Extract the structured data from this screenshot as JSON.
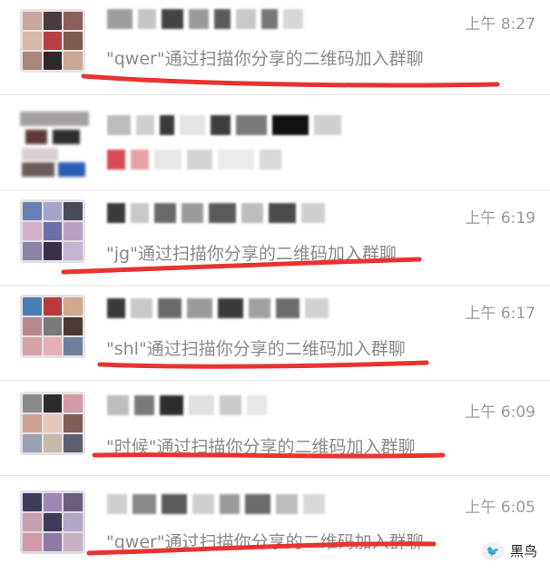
{
  "chats": [
    {
      "time": "上午 8:27",
      "message": "\"qwer\"通过扫描你分享的二维码加入群聊"
    },
    {
      "time": "",
      "message": ""
    },
    {
      "time": "上午 6:19",
      "message": "\"jg\"通过扫描你分享的二维码加入群聊"
    },
    {
      "time": "上午 6:17",
      "message": "\"shl\"通过扫描你分享的二维码加入群聊"
    },
    {
      "time": "上午 6:09",
      "message": "\"时候\"通过扫描你分享的二维码加入群聊"
    },
    {
      "time": "上午 6:05",
      "message": "\"qwer\"通过扫描你分享的二维码加入群聊"
    }
  ],
  "watermark": {
    "label": "黑鸟"
  },
  "colors": {
    "underline": "#e8332f",
    "text_secondary": "#8a8a8a",
    "time": "#9b9b9b"
  }
}
